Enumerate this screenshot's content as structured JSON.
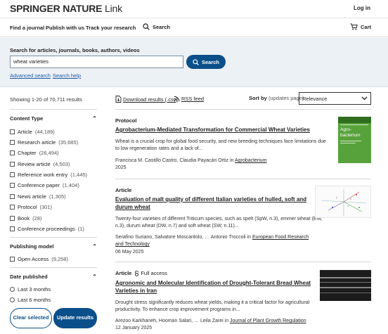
{
  "header": {
    "brand": "SPRINGER NATURE",
    "brand_suffix": "Link",
    "login": "Log in"
  },
  "nav": {
    "find_journal": "Find a journal",
    "publish": "Publish with us",
    "track": "Track your research",
    "search": "Search",
    "cart": "Cart"
  },
  "search": {
    "label": "Search for articles, journals, books, authors, videos",
    "value": "wheat varieties",
    "button": "Search",
    "advanced": "Advanced search",
    "help": "Search help"
  },
  "sidebar": {
    "showing": "Showing 1-20 of 70,711 results",
    "content_type": {
      "heading": "Content Type",
      "items": [
        {
          "label": "Article",
          "count": "(44,189)"
        },
        {
          "label": "Research article",
          "count": "(35,685)"
        },
        {
          "label": "Chapter",
          "count": "(26,494)"
        },
        {
          "label": "Review article",
          "count": "(4,503)"
        },
        {
          "label": "Reference work entry",
          "count": "(1,445)"
        },
        {
          "label": "Conference paper",
          "count": "(1,404)"
        },
        {
          "label": "News article",
          "count": "(1,305)"
        },
        {
          "label": "Protocol",
          "count": "(301)"
        },
        {
          "label": "Book",
          "count": "(28)"
        },
        {
          "label": "Conference proceedings",
          "count": "(1)"
        }
      ]
    },
    "publishing_model": {
      "heading": "Publishing model",
      "items": [
        {
          "label": "Open Access",
          "count": "(9,258)"
        }
      ]
    },
    "date_published": {
      "heading": "Date published",
      "items": [
        {
          "label": "Last 3 months"
        },
        {
          "label": "Last 6 months"
        }
      ]
    },
    "clear_button": "Clear selected",
    "update_button": "Update results"
  },
  "toolbar": {
    "download": "Download results (.csv)",
    "rss": "RSS feed",
    "sort_label": "Sort by",
    "sort_hint": "(updates page)",
    "sort_value": "Relevance"
  },
  "results": [
    {
      "type": "Protocol",
      "title": "Agrobacterium-Mediated Transformation for Commercial Wheat Varieties",
      "snippet": "Wheat is a crucial crop for global food security, and new breeding techniques face limitations due to low regeneration rates and a lack of...",
      "authors": "Francisca M. Castillo Castro, Claudia Payacán Ortiz in ",
      "journal": "Agrobacterium",
      "date": "2025",
      "thumb_text": "Agro-\nbacterium"
    },
    {
      "type": "Article",
      "title": "Evaluation of malt quality of different Italian varieties of hulled, soft and durum wheat",
      "snippet": "Twenty-four varieties of different Triticum species, such as spelt (SpW, n.3), emmer wheat (EW, n.3), durum wheat (DW, n.7) and soft wheat (SW, n.11)...",
      "authors": "Serafino Suriano, Salvatore Moscaritolo, … Antonio Troccoli in ",
      "journal": "European Food Research and Technology",
      "date": "06 May 2025"
    },
    {
      "type": "Article",
      "open_access": "Full access",
      "title": "Agronomic and Molecular Identification of Drought-Tolerant Bread Wheat Varieties in Iran",
      "snippet": "Drought stress significantly reduces wheat yields, making it a critical factor for agricultural productivity. To enhance crop improvement programs in...",
      "authors": "Arezoo Karkhaneh, Hooman Salari, … Leila Zarei in ",
      "journal": "Journal of Plant Growth Regulation",
      "date": "12 January 2025"
    }
  ],
  "colors": {
    "primary": "#0b4f8a",
    "link": "#1f5ba5",
    "search_band": "#ecf1f6"
  }
}
